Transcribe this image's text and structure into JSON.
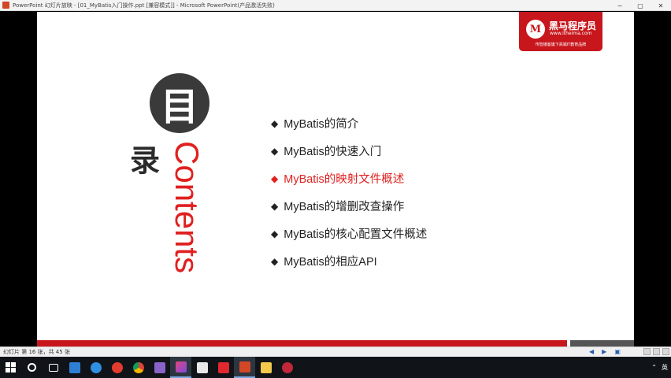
{
  "window": {
    "title": "PowerPoint 幻灯片放映 - [01_MyBatis入门操作.ppt [兼容模式]] - Microsoft PowerPoint(产品激活失败)",
    "controls": [
      "−",
      "▢",
      "✕"
    ]
  },
  "slide": {
    "logo": {
      "badge": "M",
      "brand": "黑马程序员",
      "url": "www.itheima.com",
      "slogan": "传智播客旗下高端IT教育品牌"
    },
    "toc_char_1": "目",
    "toc_char_2": "录",
    "contents_label": "Contents",
    "items": [
      {
        "label": "MyBatis的简介",
        "active": false
      },
      {
        "label": "MyBatis的快速入门",
        "active": false
      },
      {
        "label": "MyBatis的映射文件概述",
        "active": true
      },
      {
        "label": "MyBatis的增删改查操作",
        "active": false
      },
      {
        "label": "MyBatis的核心配置文件概述",
        "active": false
      },
      {
        "label": "MyBatis的相应API",
        "active": false
      }
    ],
    "colors": {
      "accent": "#c8161d",
      "highlight": "#e02020",
      "text": "#222222"
    }
  },
  "statusbar": {
    "slide_count": "幻灯片 第 16 张，共 45 张"
  },
  "taskbar": {
    "apps": [
      {
        "name": "start-icon",
        "color": "#ffffff"
      },
      {
        "name": "search-icon",
        "color": "#ffffff"
      },
      {
        "name": "task-view-icon",
        "color": "#ffffff"
      },
      {
        "name": "monitor-app-icon",
        "color": "#2d7fd3"
      },
      {
        "name": "edge-like-icon",
        "color": "#2f8fe0"
      },
      {
        "name": "red-g-app-icon",
        "color": "#e23c2f"
      },
      {
        "name": "chrome-icon",
        "color": "#4caf50"
      },
      {
        "name": "visual-studio-icon",
        "color": "#8a63c9"
      },
      {
        "name": "intellij-icon",
        "color": "#e0457b"
      },
      {
        "name": "typora-icon",
        "color": "#e8e8e8"
      },
      {
        "name": "xmind-icon",
        "color": "#e0282e"
      },
      {
        "name": "powerpoint-icon",
        "color": "#d24726"
      },
      {
        "name": "file-explorer-icon",
        "color": "#f2c94c"
      },
      {
        "name": "recorder-icon",
        "color": "#c0283a"
      }
    ],
    "tray_lang": "英"
  }
}
